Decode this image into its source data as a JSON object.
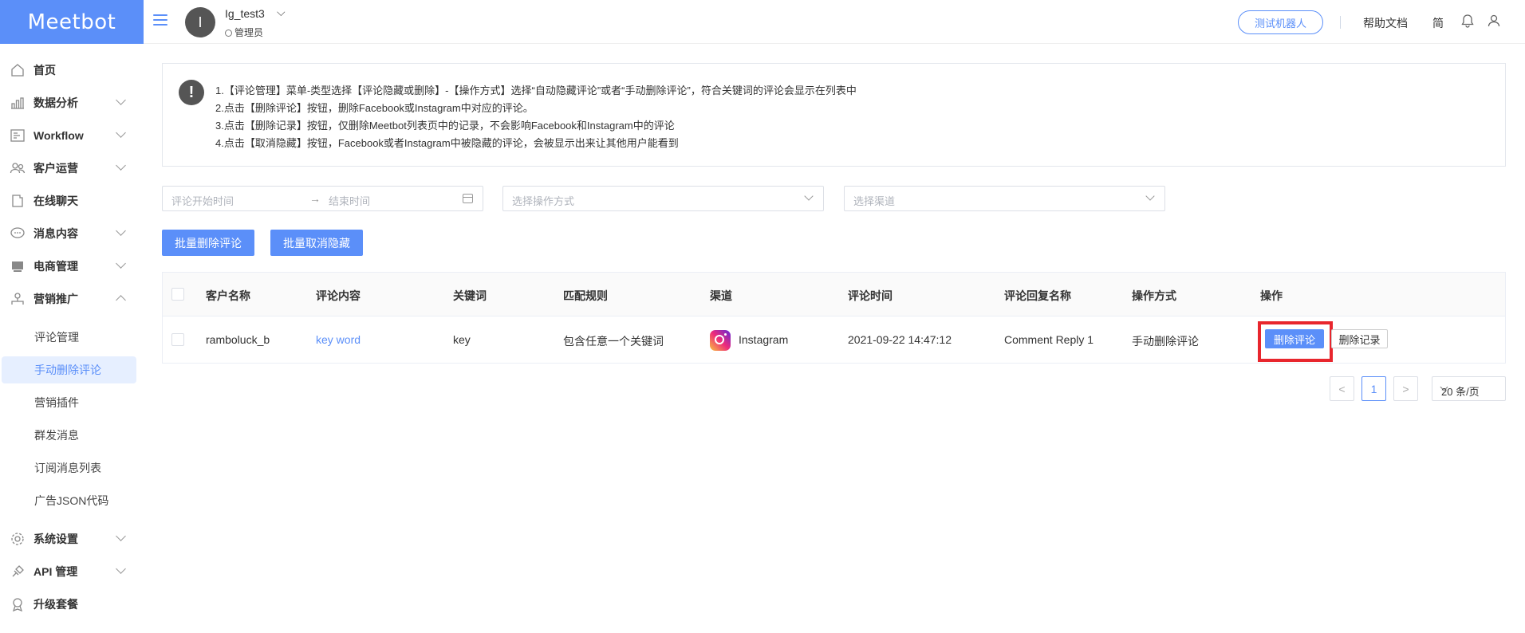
{
  "logo": "Meetbot",
  "header": {
    "avatar_letter": "I",
    "user_name": "Ig_test3",
    "user_role": "管理员",
    "test_bot": "测试机器人",
    "help_docs": "帮助文档",
    "lang": "简"
  },
  "sidebar": {
    "items": [
      {
        "label": "首页"
      },
      {
        "label": "数据分析"
      },
      {
        "label": "Workflow"
      },
      {
        "label": "客户运营"
      },
      {
        "label": "在线聊天"
      },
      {
        "label": "消息内容"
      },
      {
        "label": "电商管理"
      },
      {
        "label": "营销推广"
      },
      {
        "label": "系统设置"
      },
      {
        "label": "API 管理"
      },
      {
        "label": "升级套餐"
      }
    ],
    "sub_items": [
      {
        "label": "评论管理"
      },
      {
        "label": "手动删除评论"
      },
      {
        "label": "营销插件"
      },
      {
        "label": "群发消息"
      },
      {
        "label": "订阅消息列表"
      },
      {
        "label": "广告JSON代码"
      }
    ]
  },
  "notice": {
    "icon": "!",
    "lines": [
      "1.【评论管理】菜单-类型选择【评论隐藏或删除】-【操作方式】选择“自动隐藏评论”或者“手动删除评论”，符合关键词的评论会显示在列表中",
      "2.点击【删除评论】按钮，删除Facebook或Instagram中对应的评论。",
      "3.点击【删除记录】按钮，仅删除Meetbot列表页中的记录，不会影响Facebook和Instagram中的评论",
      "4.点击【取消隐藏】按钮，Facebook或者Instagram中被隐藏的评论，会被显示出来让其他用户能看到"
    ]
  },
  "filters": {
    "start_time": "评论开始时间",
    "arrow": "→",
    "end_time": "结束时间",
    "operation": "选择操作方式",
    "channel": "选择渠道"
  },
  "buttons": {
    "batch_delete": "批量删除评论",
    "batch_unhide": "批量取消隐藏"
  },
  "table": {
    "headers": [
      "客户名称",
      "评论内容",
      "关键词",
      "匹配规则",
      "渠道",
      "评论时间",
      "评论回复名称",
      "操作方式",
      "操作"
    ],
    "rows": [
      {
        "customer": "ramboluck_b",
        "content": "key word",
        "keyword": "key",
        "rule": "包含任意一个关键词",
        "channel": "Instagram",
        "time": "2021-09-22 14:47:12",
        "reply_name": "Comment Reply 1",
        "method": "手动删除评论",
        "delete_label": "删除评论",
        "record_label": "删除记录"
      }
    ]
  },
  "pager": {
    "prev": "<",
    "page": "1",
    "next": ">",
    "size": "20 条/页"
  },
  "colors": {
    "accent": "#5b8ff9",
    "highlight": "#e8262d"
  }
}
